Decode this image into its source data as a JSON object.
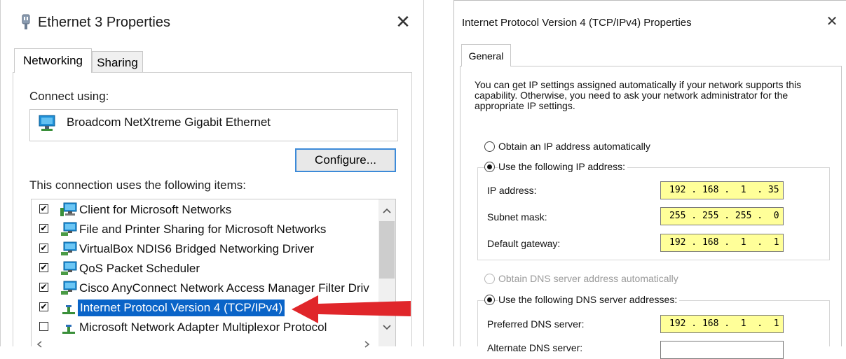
{
  "left_dialog": {
    "title": "Ethernet 3 Properties",
    "close": "✕",
    "tabs": [
      {
        "label": "Networking",
        "active": true
      },
      {
        "label": "Sharing",
        "active": false
      }
    ],
    "connect_using_label": "Connect using:",
    "adapter_name": "Broadcom NetXtreme Gigabit Ethernet",
    "configure_button": "Configure...",
    "items_label": "This connection uses the following items:",
    "items": [
      {
        "label": "Client for Microsoft Networks",
        "checked": true,
        "icon": "network-client-icon"
      },
      {
        "label": "File and Printer Sharing for Microsoft Networks",
        "checked": true,
        "icon": "network-service-icon"
      },
      {
        "label": "VirtualBox NDIS6 Bridged Networking Driver",
        "checked": true,
        "icon": "network-service-icon"
      },
      {
        "label": "QoS Packet Scheduler",
        "checked": true,
        "icon": "network-service-icon"
      },
      {
        "label": "Cisco AnyConnect Network Access Manager Filter Driv",
        "checked": true,
        "icon": "network-service-icon"
      },
      {
        "label": "Internet Protocol Version 4 (TCP/IPv4)",
        "checked": true,
        "icon": "network-protocol-icon",
        "selected": true
      },
      {
        "label": "Microsoft Network Adapter Multiplexor Protocol",
        "checked": false,
        "icon": "network-protocol-icon"
      }
    ],
    "arrow_color": "#e0262a",
    "selection_color": "#0a64c8"
  },
  "right_dialog": {
    "title": "Internet Protocol Version 4 (TCP/IPv4) Properties",
    "close": "✕",
    "tab": "General",
    "intro": "You can get IP settings assigned automatically if your network supports this capability. Otherwise, you need to ask your network administrator for the appropriate IP settings.",
    "ip_auto_label": "Obtain an IP address automatically",
    "ip_manual_label": "Use the following IP address:",
    "ip_fields": [
      {
        "label": "IP address:",
        "value": "192 . 168 .  1  . 35"
      },
      {
        "label": "Subnet mask:",
        "value": "255 . 255 . 255 .  0"
      },
      {
        "label": "Default gateway:",
        "value": "192 . 168 .  1  .  1"
      }
    ],
    "dns_auto_label": "Obtain DNS server address automatically",
    "dns_manual_label": "Use the following DNS server addresses:",
    "dns_fields": [
      {
        "label": "Preferred DNS server:",
        "value": "192 . 168 .  1  .  1"
      },
      {
        "label": "Alternate DNS server:",
        "value": ""
      }
    ],
    "highlight_color": "#ffff99"
  }
}
